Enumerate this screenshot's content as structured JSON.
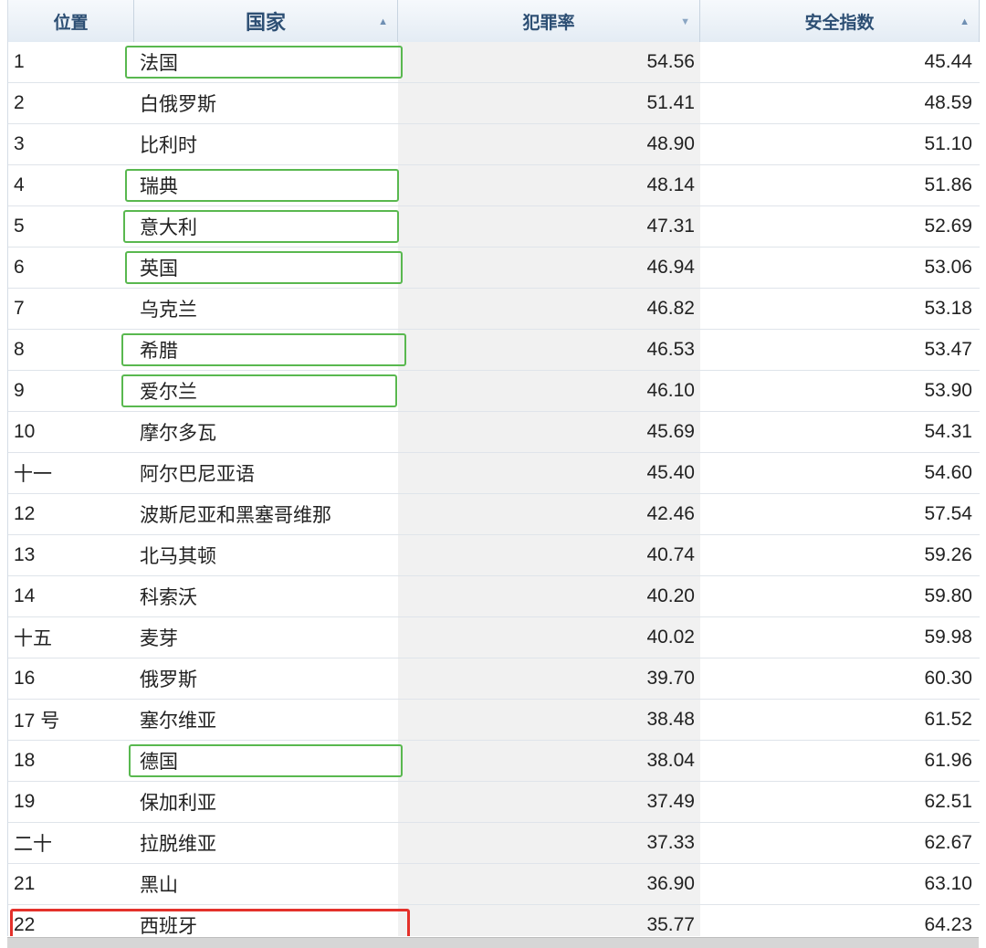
{
  "table": {
    "headers": {
      "position": "位置",
      "country": "国家",
      "crime": "犯罪率",
      "safety": "安全指数"
    },
    "rows": [
      {
        "pos": "1",
        "country": "法国",
        "crime": "54.56",
        "safety": "45.44",
        "highlight": "green"
      },
      {
        "pos": "2",
        "country": "白俄罗斯",
        "crime": "51.41",
        "safety": "48.59",
        "highlight": ""
      },
      {
        "pos": "3",
        "country": "比利时",
        "crime": "48.90",
        "safety": "51.10",
        "highlight": ""
      },
      {
        "pos": "4",
        "country": "瑞典",
        "crime": "48.14",
        "safety": "51.86",
        "highlight": "green"
      },
      {
        "pos": "5",
        "country": "意大利",
        "crime": "47.31",
        "safety": "52.69",
        "highlight": "green"
      },
      {
        "pos": "6",
        "country": "英国",
        "crime": "46.94",
        "safety": "53.06",
        "highlight": "green"
      },
      {
        "pos": "7",
        "country": "乌克兰",
        "crime": "46.82",
        "safety": "53.18",
        "highlight": ""
      },
      {
        "pos": "8",
        "country": "希腊",
        "crime": "46.53",
        "safety": "53.47",
        "highlight": "green"
      },
      {
        "pos": "9",
        "country": "爱尔兰",
        "crime": "46.10",
        "safety": "53.90",
        "highlight": "green"
      },
      {
        "pos": "10",
        "country": "摩尔多瓦",
        "crime": "45.69",
        "safety": "54.31",
        "highlight": ""
      },
      {
        "pos": "十一",
        "country": "阿尔巴尼亚语",
        "crime": "45.40",
        "safety": "54.60",
        "highlight": ""
      },
      {
        "pos": "12",
        "country": "波斯尼亚和黑塞哥维那",
        "crime": "42.46",
        "safety": "57.54",
        "highlight": ""
      },
      {
        "pos": "13",
        "country": "北马其顿",
        "crime": "40.74",
        "safety": "59.26",
        "highlight": ""
      },
      {
        "pos": "14",
        "country": "科索沃",
        "crime": "40.20",
        "safety": "59.80",
        "highlight": ""
      },
      {
        "pos": "十五",
        "country": "麦芽",
        "crime": "40.02",
        "safety": "59.98",
        "highlight": ""
      },
      {
        "pos": "16",
        "country": "俄罗斯",
        "crime": "39.70",
        "safety": "60.30",
        "highlight": ""
      },
      {
        "pos": "17 号",
        "country": "塞尔维亚",
        "crime": "38.48",
        "safety": "61.52",
        "highlight": ""
      },
      {
        "pos": "18",
        "country": "德国",
        "crime": "38.04",
        "safety": "61.96",
        "highlight": "green"
      },
      {
        "pos": "19",
        "country": "保加利亚",
        "crime": "37.49",
        "safety": "62.51",
        "highlight": ""
      },
      {
        "pos": "二十",
        "country": "拉脱维亚",
        "crime": "37.33",
        "safety": "62.67",
        "highlight": ""
      },
      {
        "pos": "21",
        "country": "黑山",
        "crime": "36.90",
        "safety": "63.10",
        "highlight": ""
      },
      {
        "pos": "22",
        "country": "西班牙",
        "crime": "35.77",
        "safety": "64.23",
        "highlight": "red"
      }
    ]
  },
  "colors": {
    "highlight_green": "#59b84f",
    "highlight_red": "#e4312b",
    "header_text": "#2d4f74"
  }
}
